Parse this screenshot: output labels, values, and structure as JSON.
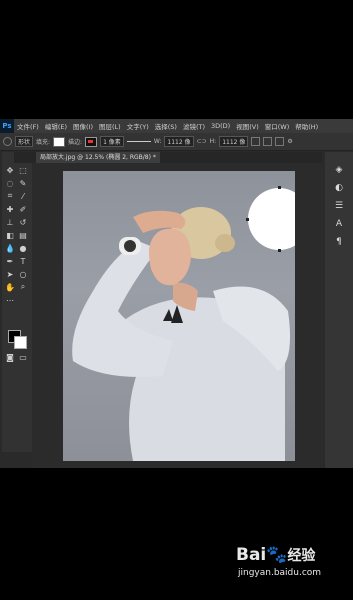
{
  "app": {
    "logo": "Ps"
  },
  "menu": [
    "文件(F)",
    "编辑(E)",
    "图像(I)",
    "图层(L)",
    "文字(Y)",
    "选择(S)",
    "滤镜(T)",
    "3D(D)",
    "视图(V)",
    "窗口(W)",
    "帮助(H)"
  ],
  "options": {
    "mode": "形状",
    "fill_label": "填充:",
    "stroke_label": "描边:",
    "stroke_width": "1 像素",
    "w_label": "W:",
    "w_value": "1112 像",
    "h_label": "H:",
    "h_value": "1112 像"
  },
  "document": {
    "tab_title": "局部放大.jpg @ 12.5% (椭圆 2, RGB/8) *"
  },
  "watermark": {
    "brand": "Bai",
    "brand_suffix": "经验",
    "url": "jingyan.baidu.com"
  },
  "colors": {
    "foreground": "#000000",
    "background": "#ffffff"
  }
}
